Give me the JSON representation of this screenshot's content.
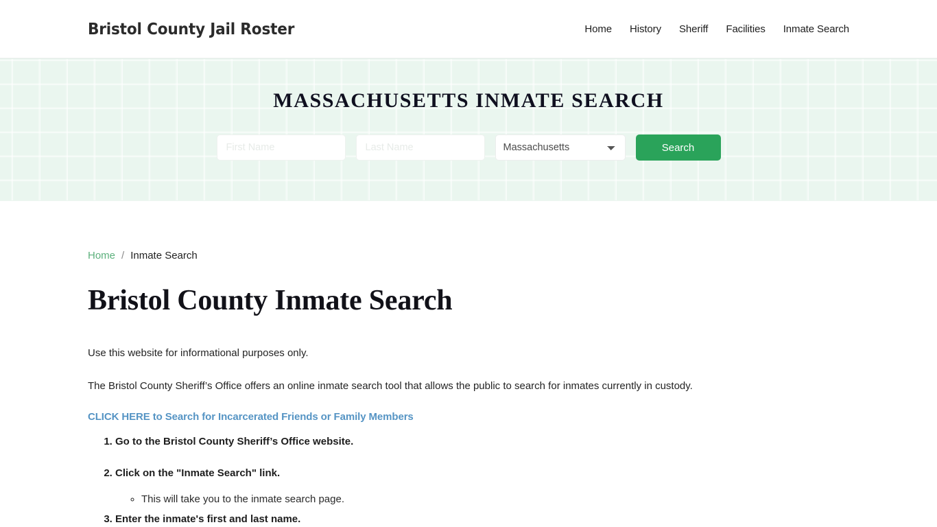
{
  "header": {
    "brand": "Bristol County Jail Roster",
    "nav": [
      {
        "label": "Home"
      },
      {
        "label": "History"
      },
      {
        "label": "Sheriff"
      },
      {
        "label": "Facilities"
      },
      {
        "label": "Inmate Search"
      }
    ]
  },
  "hero": {
    "title": "MASSACHUSETTS INMATE SEARCH",
    "form": {
      "first_name_value": "",
      "first_name_placeholder": "First Name",
      "last_name_value": "",
      "last_name_placeholder": "Last Name",
      "state_selected": "Massachusetts",
      "state_options": [
        "Massachusetts"
      ],
      "search_label": "Search",
      "search_button_color": "#2aa35a"
    }
  },
  "breadcrumb": {
    "home_label": "Home",
    "separator": "/",
    "current_label": "Inmate Search",
    "link_color": "#5cb07c"
  },
  "main": {
    "page_title": "Bristol County Inmate Search",
    "paragraph_1": "Use this website for informational purposes only.",
    "paragraph_2": "The Bristol County Sheriff’s Office offers an online inmate search tool that allows the public to search for inmates currently in custody.",
    "cta_link": "CLICK HERE to Search for Incarcerated Friends or Family Members",
    "cta_link_color": "#5594c4",
    "steps": [
      {
        "text": "Go to the Bristol County Sheriff’s Office website."
      },
      {
        "text": "Click on the \"Inmate Search\" link.",
        "substeps": [
          {
            "text": "This will take you to the inmate search page."
          }
        ]
      },
      {
        "text": "Enter the inmate's first and last name."
      }
    ]
  }
}
